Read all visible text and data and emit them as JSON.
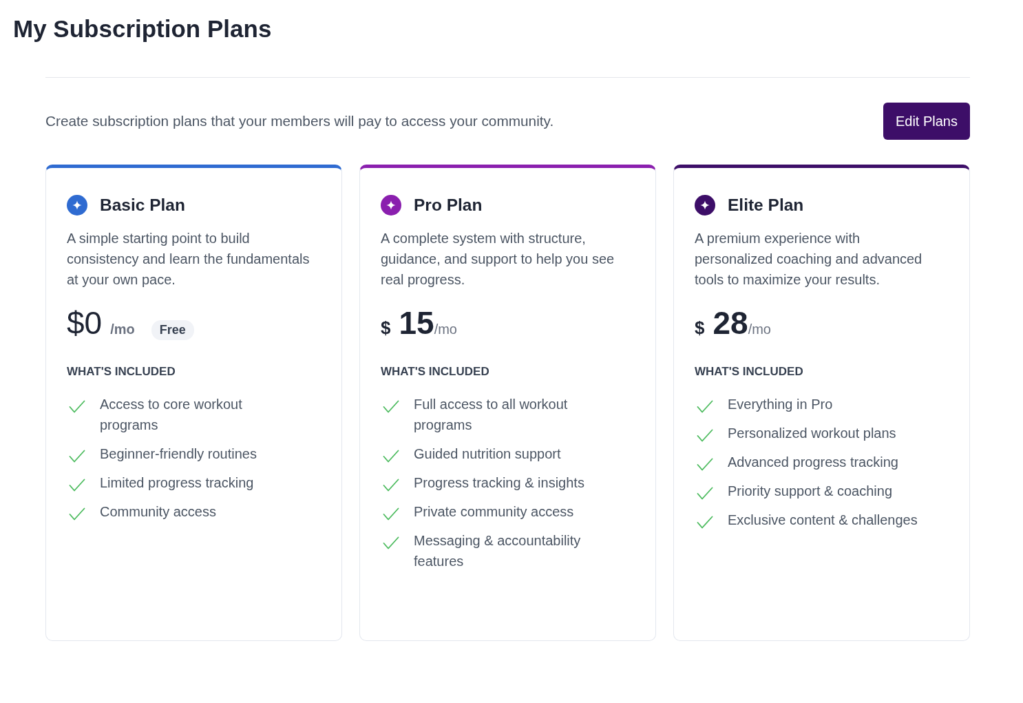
{
  "page": {
    "title": "My Subscription Plans"
  },
  "header": {
    "description": "Create subscription plans that your members will pay to access your community.",
    "button": "Edit Plans"
  },
  "plans": [
    {
      "name": "Basic Plan",
      "color": "#2f6bd1",
      "description": "A simple starting point to build consistency and learn the fundamentals at your own pace.",
      "price": {
        "kind": "free",
        "amount": "$0",
        "period": "/mo",
        "badge": "Free"
      },
      "features_heading": "WHAT'S INCLUDED",
      "features": [
        "Access to core workout programs",
        "Beginner-friendly routines",
        "Limited progress tracking",
        "Community access"
      ]
    },
    {
      "name": "Pro Plan",
      "color": "#8a1fae",
      "description": "A complete system with structure, guidance, and support to help you see real progress.",
      "price": {
        "kind": "paid",
        "currency": "$",
        "amount": "15",
        "period": "/mo"
      },
      "features_heading": "WHAT'S INCLUDED",
      "features": [
        "Full access to all workout programs",
        "Guided nutrition support",
        "Progress tracking & insights",
        "Private community access",
        "Messaging & accountability features"
      ]
    },
    {
      "name": "Elite Plan",
      "color": "#3d0e68",
      "description": "A premium experience with personalized coaching and advanced tools to maximize your results.",
      "price": {
        "kind": "paid",
        "currency": "$",
        "amount": "28",
        "period": "/mo"
      },
      "features_heading": "WHAT'S INCLUDED",
      "features": [
        "Everything in Pro",
        "Personalized workout plans",
        "Advanced progress tracking",
        "Priority support & coaching",
        "Exclusive content & challenges"
      ]
    }
  ]
}
